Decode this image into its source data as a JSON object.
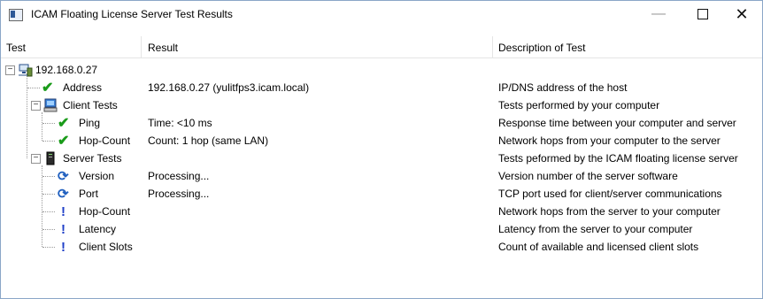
{
  "window": {
    "title": "ICAM Floating License Server Test Results",
    "minimize_glyph": "—",
    "close_glyph": "✕"
  },
  "columns": [
    "Test",
    "Result",
    "Description of Test"
  ],
  "tree": {
    "host": {
      "label": "192.168.0.27",
      "icon": "network-host-icon"
    },
    "address": {
      "label": "Address",
      "result": "192.168.0.27 (yulitfps3.icam.local)",
      "description": "IP/DNS address of the host",
      "status": "check"
    },
    "client_tests": {
      "label": "Client Tests",
      "description": "Tests performed by your computer",
      "icon": "computer-icon",
      "items": [
        {
          "label": "Ping",
          "result": "Time: <10 ms",
          "description": "Response time between your computer and server",
          "status": "check"
        },
        {
          "label": "Hop-Count",
          "result": "Count: 1 hop (same LAN)",
          "description": "Network hops from your computer to the server",
          "status": "check"
        }
      ]
    },
    "server_tests": {
      "label": "Server Tests",
      "description": "Tests peformed by the ICAM floating license server",
      "icon": "server-icon",
      "items": [
        {
          "label": "Version",
          "result": "Processing...",
          "description": "Version number of the server software",
          "status": "processing"
        },
        {
          "label": "Port",
          "result": "Processing...",
          "description": "TCP port used for client/server communications",
          "status": "processing"
        },
        {
          "label": "Hop-Count",
          "result": "",
          "description": "Network hops from the server to your computer",
          "status": "pending"
        },
        {
          "label": "Latency",
          "result": "",
          "description": "Latency from the server to your computer",
          "status": "pending"
        },
        {
          "label": "Client Slots",
          "result": "",
          "description": "Count of available and licensed client slots",
          "status": "pending"
        }
      ]
    }
  },
  "colors": {
    "check": "#1a9b1a",
    "processing": "#1f5fbf",
    "pending": "#1f3fc8"
  }
}
